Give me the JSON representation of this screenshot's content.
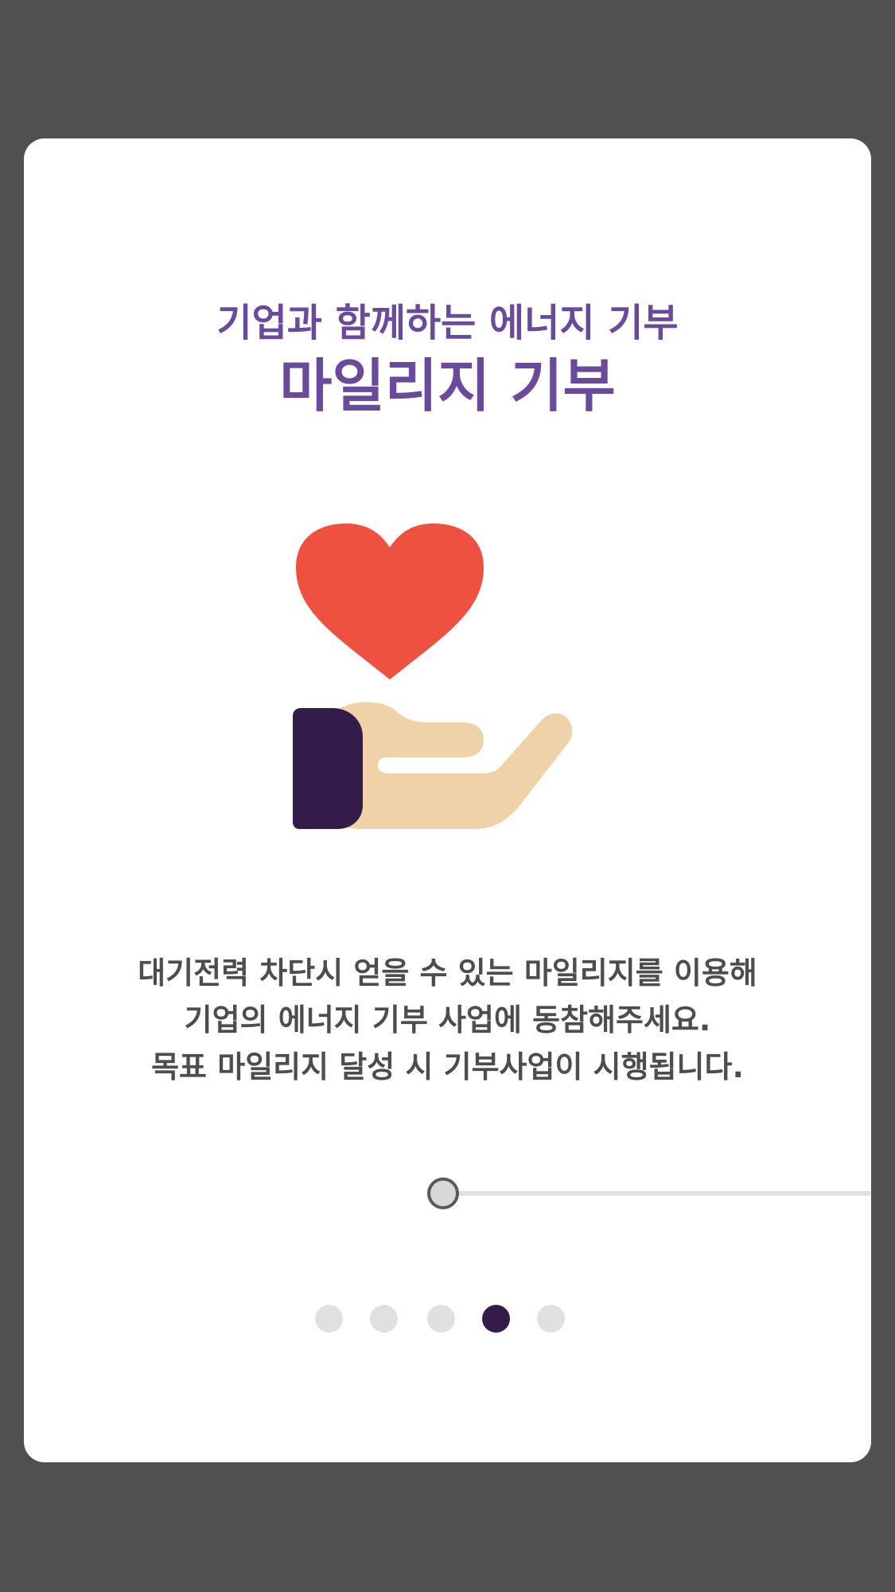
{
  "card": {
    "subtitle": "기업과 함께하는 에너지 기부",
    "title": "마일리지 기부",
    "description_lines": [
      "대기전력 차단시 얻을 수 있는 마일리지를 이용해",
      "기업의 에너지 기부 사업에 동참해주세요.",
      "목표 마일리지 달성 시 기부사업이 시행됩니다."
    ],
    "illustration": "hand-holding-heart-icon",
    "slider_value": 0
  },
  "pager": {
    "total": 5,
    "active_index": 3
  },
  "colors": {
    "background": "#505050",
    "accent": "#6a4b9b",
    "text": "#4d4d4d",
    "heart": "#ee5140",
    "hand": "#efd2a8",
    "sleeve": "#331c4a",
    "dot_active": "#331c4a",
    "dot_inactive": "#e0e0e0"
  }
}
